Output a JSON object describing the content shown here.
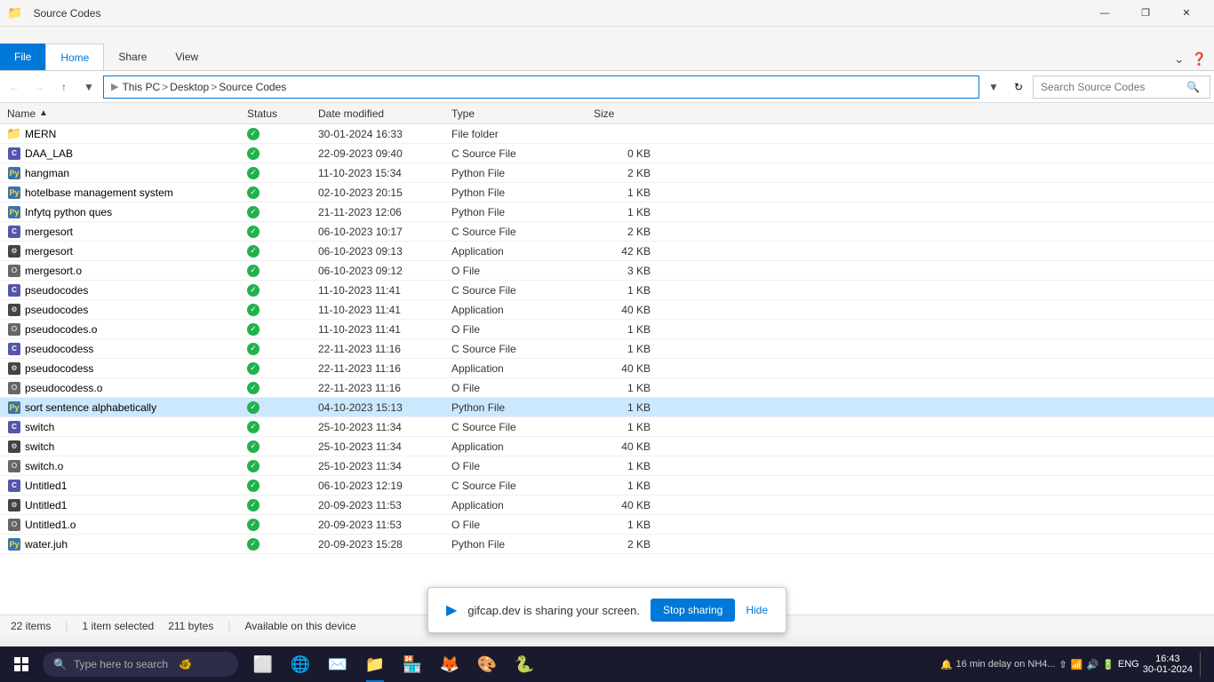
{
  "window": {
    "title": "Source Codes",
    "minimize": "—",
    "maximize": "❐",
    "close": "✕"
  },
  "ribbon": {
    "tabs": [
      {
        "label": "File",
        "type": "file"
      },
      {
        "label": "Home",
        "type": "normal",
        "active": true
      },
      {
        "label": "Share",
        "type": "normal"
      },
      {
        "label": "View",
        "type": "normal"
      }
    ]
  },
  "addressbar": {
    "back_disabled": false,
    "forward_disabled": false,
    "up": "⬆",
    "path": "This PC > Desktop > Source Codes",
    "path_parts": [
      "This PC",
      "Desktop",
      "Source Codes"
    ],
    "search_placeholder": "Search Source Codes"
  },
  "column_headers": {
    "name": "Name",
    "status": "Status",
    "date_modified": "Date modified",
    "type": "Type",
    "size": "Size"
  },
  "files": [
    {
      "name": "MERN",
      "type_icon": "folder",
      "status": true,
      "date": "30-01-2024 16:33",
      "type": "File folder",
      "size": ""
    },
    {
      "name": "DAA_LAB",
      "type_icon": "c",
      "status": true,
      "date": "22-09-2023 09:40",
      "type": "C Source File",
      "size": "0 KB"
    },
    {
      "name": "hangman",
      "type_icon": "python",
      "status": true,
      "date": "11-10-2023 15:34",
      "type": "Python File",
      "size": "2 KB"
    },
    {
      "name": "hotelbase management system",
      "type_icon": "python",
      "status": true,
      "date": "02-10-2023 20:15",
      "type": "Python File",
      "size": "1 KB"
    },
    {
      "name": "Infytq python ques",
      "type_icon": "python",
      "status": true,
      "date": "21-11-2023 12:06",
      "type": "Python File",
      "size": "1 KB"
    },
    {
      "name": "mergesort",
      "type_icon": "c",
      "status": true,
      "date": "06-10-2023 10:17",
      "type": "C Source File",
      "size": "2 KB"
    },
    {
      "name": "mergesort",
      "type_icon": "app",
      "status": true,
      "date": "06-10-2023 09:13",
      "type": "Application",
      "size": "42 KB"
    },
    {
      "name": "mergesort.o",
      "type_icon": "o",
      "status": true,
      "date": "06-10-2023 09:12",
      "type": "O File",
      "size": "3 KB"
    },
    {
      "name": "pseudocodes",
      "type_icon": "c",
      "status": true,
      "date": "11-10-2023 11:41",
      "type": "C Source File",
      "size": "1 KB"
    },
    {
      "name": "pseudocodes",
      "type_icon": "app",
      "status": true,
      "date": "11-10-2023 11:41",
      "type": "Application",
      "size": "40 KB"
    },
    {
      "name": "pseudocodes.o",
      "type_icon": "o",
      "status": true,
      "date": "11-10-2023 11:41",
      "type": "O File",
      "size": "1 KB"
    },
    {
      "name": "pseudocodess",
      "type_icon": "c",
      "status": true,
      "date": "22-11-2023 11:16",
      "type": "C Source File",
      "size": "1 KB"
    },
    {
      "name": "pseudocodess",
      "type_icon": "app",
      "status": true,
      "date": "22-11-2023 11:16",
      "type": "Application",
      "size": "40 KB"
    },
    {
      "name": "pseudocodess.o",
      "type_icon": "o",
      "status": true,
      "date": "22-11-2023 11:16",
      "type": "O File",
      "size": "1 KB"
    },
    {
      "name": "sort sentence alphabetically",
      "type_icon": "python",
      "status": true,
      "date": "04-10-2023 15:13",
      "type": "Python File",
      "size": "1 KB",
      "selected": true
    },
    {
      "name": "switch",
      "type_icon": "c",
      "status": true,
      "date": "25-10-2023 11:34",
      "type": "C Source File",
      "size": "1 KB"
    },
    {
      "name": "switch",
      "type_icon": "app",
      "status": true,
      "date": "25-10-2023 11:34",
      "type": "Application",
      "size": "40 KB"
    },
    {
      "name": "switch.o",
      "type_icon": "o",
      "status": true,
      "date": "25-10-2023 11:34",
      "type": "O File",
      "size": "1 KB"
    },
    {
      "name": "Untitled1",
      "type_icon": "c",
      "status": true,
      "date": "06-10-2023 12:19",
      "type": "C Source File",
      "size": "1 KB"
    },
    {
      "name": "Untitled1",
      "type_icon": "app",
      "status": true,
      "date": "20-09-2023 11:53",
      "type": "Application",
      "size": "40 KB"
    },
    {
      "name": "Untitled1.o",
      "type_icon": "o",
      "status": true,
      "date": "20-09-2023 11:53",
      "type": "O File",
      "size": "1 KB"
    },
    {
      "name": "water.juh",
      "type_icon": "python",
      "status": true,
      "date": "20-09-2023 15:28",
      "type": "Python File",
      "size": "2 KB"
    }
  ],
  "status_bar": {
    "item_count": "22 items",
    "selected": "1 item selected",
    "size": "211 bytes",
    "available": "Available on this device"
  },
  "screen_share": {
    "message": "gifcap.dev is sharing your screen.",
    "stop_label": "Stop sharing",
    "hide_label": "Hide"
  },
  "taskbar": {
    "search_placeholder": "Type here to search",
    "time": "16:43",
    "date": "30-01-2024",
    "language": "ENG",
    "notification": "16 min delay on NH4..."
  }
}
